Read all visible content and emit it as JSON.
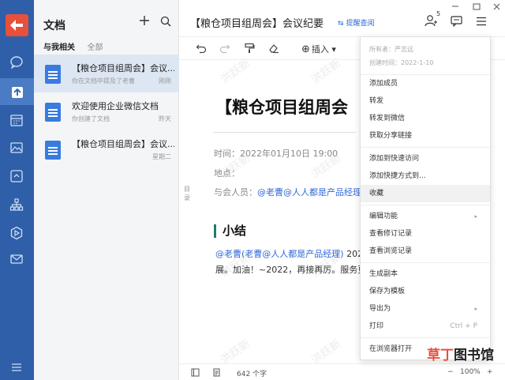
{
  "sidebar": {
    "icons": [
      "app-logo-icon",
      "chat-icon",
      "docs-icon",
      "calendar-icon",
      "image-icon",
      "org-chart-icon",
      "workbench-icon",
      "mail-icon",
      "menu-icon"
    ],
    "brand_color": "#2f5fa8",
    "logo_color": "#e7503b"
  },
  "doclist": {
    "title": "文档",
    "filters": [
      "与我相关",
      "全部"
    ],
    "items": [
      {
        "name": "【粮仓项目组周会】会议...",
        "sub": "你在文档中提及了老曹",
        "time": "刚刚"
      },
      {
        "name": "欢迎使用企业微信文档",
        "sub": "你创建了文档",
        "time": "昨天"
      },
      {
        "name": "【粮仓项目组周会】会议...",
        "sub": "",
        "time": "星期二"
      }
    ]
  },
  "header": {
    "title": "【粮仓项目组周会】会议纪要",
    "remind": "提醒查阅",
    "member_count": "5"
  },
  "toolbar": {
    "insert_label": "插入"
  },
  "document": {
    "heading": "【粮仓项目组周会",
    "time_label": "时间：2022年01月10日 19:00",
    "place_label": "地点：",
    "attendees_label": "与会人员：",
    "attendees_mention": "@老曹@人人都是产品经理",
    "toc_label": "目录",
    "section_title": "小结",
    "para_line1_mention": "@老曹(老曹@人人都是产品经理)",
    "para_line1_rest": " 202",
    "para_line2": "展。加油！~2022，再接再厉。服务更"
  },
  "watermark": "洪跃新",
  "statusbar": {
    "word_count": "642 个字",
    "zoom": "100%"
  },
  "menu": {
    "owner": "所有者：严志远",
    "created": "创建时间：2022-1-10",
    "groups": [
      [
        "添加成员",
        "转发",
        "转发到微信",
        "获取分享链接"
      ],
      [
        "添加到快速访问",
        "添加快捷方式到...",
        "收藏"
      ],
      [
        "编辑功能",
        "查看修订记录",
        "查看浏览记录"
      ],
      [
        "生成副本",
        "保存为模板",
        "导出为",
        "打印"
      ],
      [
        "在浏览器打开"
      ]
    ],
    "print_shortcut": "Ctrl + P",
    "highlighted": "收藏"
  },
  "brand": {
    "part1": "草丁",
    "part2": "图书馆"
  }
}
